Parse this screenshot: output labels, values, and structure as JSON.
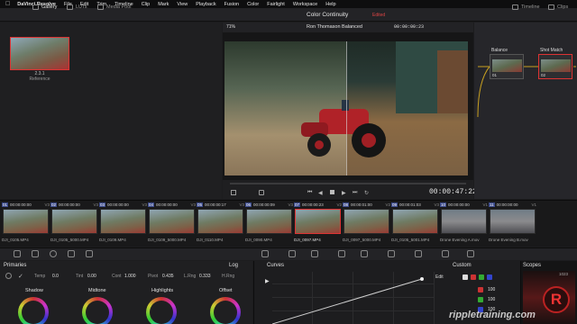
{
  "menubar": {
    "app": "DaVinci Resolve",
    "items": [
      "File",
      "Edit",
      "Trim",
      "Timeline",
      "Clip",
      "Mark",
      "View",
      "Playback",
      "Fusion",
      "Color",
      "Fairlight",
      "Workspace",
      "Help"
    ]
  },
  "toolbar": {
    "gallery": "Gallery",
    "luts": "LUTs",
    "media_pool": "Media Pool",
    "project_title": "Color Continuity",
    "edited": "Edited",
    "timeline": "Timeline",
    "clips": "Clips"
  },
  "gallery": {
    "still_number": "2.3.1",
    "still_label": "Reference"
  },
  "viewer": {
    "zoom": "71%",
    "timeline_name": "Ron Thomason Balanced",
    "timecode_top": "00:00:00:23",
    "timecode": "00:00:47:22"
  },
  "nodes": {
    "node1_title": "Balance",
    "node1_num": "01",
    "node2_title": "Shot Match",
    "node2_num": "02"
  },
  "clips": [
    {
      "num": "01",
      "tc": "00:00:00:00",
      "track": "V3",
      "name": "DJI_0105.MP4"
    },
    {
      "num": "02",
      "tc": "00:00:00:00",
      "track": "V3",
      "name": "DJI_0105_5000.MP4"
    },
    {
      "num": "03",
      "tc": "00:00:00:00",
      "track": "V3",
      "name": "DJI_0109.MP4"
    },
    {
      "num": "04",
      "tc": "00:00:00:00",
      "track": "V3",
      "name": "DJI_0109_5000.MP4"
    },
    {
      "num": "05",
      "tc": "00:00:00:17",
      "track": "V3",
      "name": "DJI_0110.MP4"
    },
    {
      "num": "06",
      "tc": "00:00:00:09",
      "track": "V3",
      "name": "DJI_0090.MP4"
    },
    {
      "num": "07",
      "tc": "00:00:00:23",
      "track": "V2",
      "name": "DJI_0097.MP4"
    },
    {
      "num": "08",
      "tc": "00:00:01:00",
      "track": "V2",
      "name": "DJI_0097_5000.MP4"
    },
    {
      "num": "09",
      "tc": "00:00:01:03",
      "track": "V3",
      "name": "DJI_0105_5001.MP4"
    },
    {
      "num": "10",
      "tc": "00:00:00:00",
      "track": "V1",
      "name": "Drone Evening A.mov"
    },
    {
      "num": "11",
      "tc": "00:00:00:00",
      "track": "V1",
      "name": "Drone Evening B.mov"
    }
  ],
  "primaries": {
    "title": "Primaries",
    "mode": "Log",
    "temp_label": "Temp",
    "temp_value": "0.0",
    "tint_label": "Tint",
    "tint_value": "0.00",
    "cont_label": "Cont",
    "cont_value": "1.000",
    "pivot_label": "Pivot",
    "pivot_value": "0.435",
    "lrng_label": "L.Rng",
    "lrng_value": "0.333",
    "hrng_label": "H.Rng",
    "wheels": [
      "Shadow",
      "Midtone",
      "Highlights",
      "Offset"
    ]
  },
  "curves": {
    "title": "Curves",
    "mode": "Custom",
    "edit": "Edit",
    "channels": [
      "Y",
      "R",
      "G",
      "B"
    ],
    "values": [
      "100",
      "100",
      "100"
    ]
  },
  "scopes": {
    "title": "Scopes",
    "value": "1023"
  },
  "watermark": "rippletraining.com",
  "colors": {
    "accent_red": "#dd3333",
    "clip_num_blue": "#3b4a8a",
    "node_link": "#c8a020"
  }
}
